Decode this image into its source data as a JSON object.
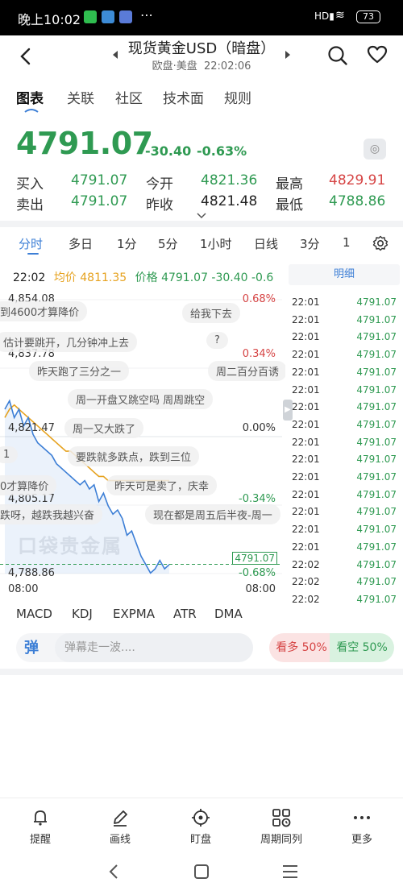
{
  "status_bar": {
    "time": "晚上10:02",
    "battery": "73"
  },
  "header": {
    "title": "现货黄金USD（暗盘）",
    "session": "欧盘·美盘",
    "clock": "22:02:06"
  },
  "tabs": [
    "图表",
    "关联",
    "社区",
    "技术面",
    "规则"
  ],
  "quote": {
    "price": "4791.07",
    "change": "-30.40",
    "change_pct": "-0.63%",
    "buy_label": "买入",
    "buy": "4791.07",
    "sell_label": "卖出",
    "sell": "4791.07",
    "open_label": "今开",
    "open": "4821.36",
    "prev_label": "昨收",
    "prev": "4821.48",
    "high_label": "最高",
    "high": "4829.91",
    "low_label": "最低",
    "low": "4788.86"
  },
  "periods": [
    "分时",
    "多日",
    "1分",
    "5分",
    "1小时",
    "日线",
    "3分",
    "1"
  ],
  "chart_info": {
    "time": "22:02",
    "avg_label": "均价",
    "avg": "4811.35",
    "price_label": "价格",
    "price_text": "4791.07 -30.40 -0.6"
  },
  "chart": {
    "y_labels": [
      "4,854.08",
      "4,837.78",
      "4,821.47",
      "4,805.17",
      "4,788.86"
    ],
    "y_right": [
      "0.68%",
      "0.34%",
      "0.00%",
      "-0.34%",
      "-0.68%"
    ],
    "current_tag": "4791.07",
    "x_start": "08:00",
    "x_end": "08:00",
    "watermark": "口袋贵金属"
  },
  "chart_data": {
    "type": "line",
    "series": [
      {
        "values": [
          4828,
          4830,
          4826,
          4828,
          4824,
          4826,
          4822,
          4820,
          4819,
          4818,
          4817,
          4815,
          4814,
          4813,
          4812,
          4811,
          4810,
          4811,
          4809,
          4810,
          4806,
          4808,
          4805,
          4803,
          4804,
          4802,
          4798,
          4799,
          4796,
          4793,
          4791,
          4789,
          4790,
          4792,
          4790,
          4791
        ]
      },
      {
        "values": [
          4826,
          4828,
          4829,
          4828,
          4827,
          4826,
          4825,
          4824,
          4823,
          4822,
          4821,
          4820,
          4819,
          4818,
          4818,
          4817,
          4816,
          4815,
          4814,
          4813,
          4812,
          4812,
          4811,
          4811,
          4811,
          4811,
          4811,
          4811,
          4811,
          4811,
          4811,
          4811,
          4811,
          4811,
          4811,
          4811
        ]
      }
    ],
    "ylim": [
      4788.86,
      4854.08
    ]
  },
  "danmaku": [
    "到4600才算降价",
    "给我下去",
    "估计要跳开，几分钟冲上去",
    "?",
    "昨天跑了三分之一",
    "周二百分百诱",
    "周一开盘又跳空吗 周周跳空",
    "周一又大跌了",
    "要跌就多跌点，跌到三位",
    "1",
    "0才算降价",
    "昨天可是卖了，庆幸",
    "跌呀，越跌我越兴奋",
    "现在都是周五后半夜-周一"
  ],
  "ticks_header": "明细",
  "ticks": [
    {
      "t": "22:01",
      "p": "4791.07"
    },
    {
      "t": "22:01",
      "p": "4791.07"
    },
    {
      "t": "22:01",
      "p": "4791.07"
    },
    {
      "t": "22:01",
      "p": "4791.07"
    },
    {
      "t": "22:01",
      "p": "4791.07"
    },
    {
      "t": "22:01",
      "p": "4791.07"
    },
    {
      "t": "22:01",
      "p": "4791.07"
    },
    {
      "t": "22:01",
      "p": "4791.07"
    },
    {
      "t": "22:01",
      "p": "4791.07"
    },
    {
      "t": "22:01",
      "p": "4791.07"
    },
    {
      "t": "22:01",
      "p": "4791.07"
    },
    {
      "t": "22:01",
      "p": "4791.07"
    },
    {
      "t": "22:01",
      "p": "4791.07"
    },
    {
      "t": "22:01",
      "p": "4791.07"
    },
    {
      "t": "22:01",
      "p": "4791.07"
    },
    {
      "t": "22:02",
      "p": "4791.07"
    },
    {
      "t": "22:02",
      "p": "4791.07"
    },
    {
      "t": "22:02",
      "p": "4791.07"
    }
  ],
  "indicators": [
    "MACD",
    "KDJ",
    "EXPMA",
    "ATR",
    "DMA"
  ],
  "danmu": {
    "icon": "弹",
    "placeholder": "弹幕走一波...."
  },
  "sentiment": {
    "bull": "看多 50%",
    "bear": "看空 50%"
  },
  "bottom_nav": [
    "提醒",
    "画线",
    "盯盘",
    "周期同列",
    "更多"
  ],
  "colors": {
    "green": "#2f9a52",
    "red": "#d64545",
    "avg_line": "#e6a21f",
    "price_line": "#3d7fd6"
  }
}
